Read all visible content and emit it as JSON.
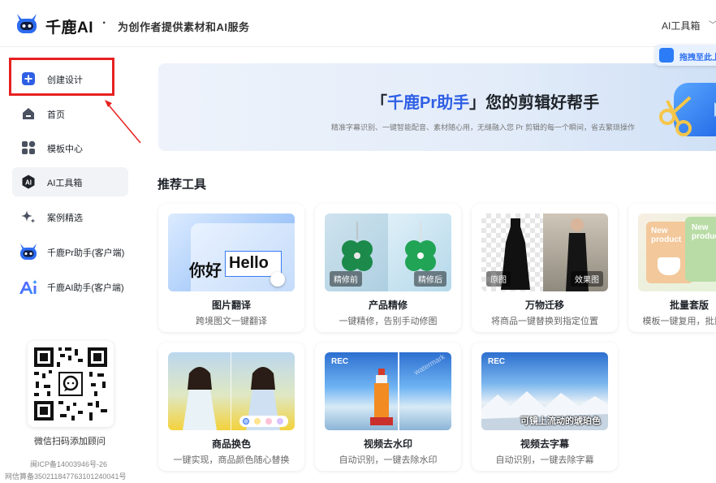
{
  "header": {
    "brand": "千鹿AI",
    "dot": "·",
    "slogan": "为创作者提供素材和AI服务",
    "right_menu": "AI工具箱"
  },
  "sidebar": {
    "items": [
      {
        "label": "创建设计",
        "icon": "plus-square-icon"
      },
      {
        "label": "首页",
        "icon": "home-icon"
      },
      {
        "label": "模板中心",
        "icon": "template-grid-icon"
      },
      {
        "label": "AI工具箱",
        "icon": "ai-toolbox-icon"
      },
      {
        "label": "案例精选",
        "icon": "sparkle-icon"
      },
      {
        "label": "千鹿Pr助手(客户端)",
        "icon": "qianlu-robot-icon"
      },
      {
        "label": "千鹿AI助手(客户端)",
        "icon": "ai-sparkle-icon"
      }
    ],
    "qr_caption": "微信扫码添加顾问",
    "icp": "闽ICP备14003946号-26",
    "gongan": "网信算备350211847763101240041号"
  },
  "banner": {
    "title_open": "「",
    "title_highlight": "千鹿Pr助手",
    "title_close": "」您的剪辑好帮手",
    "subtitle": "精准字幕识别、一键智能配音、素材随心用，无缝融入您 Pr 剪辑的每一个瞬间，省去繁琐操作",
    "float_badge": "拖拽至此上"
  },
  "section_title": "推荐工具",
  "tools": [
    {
      "title": "图片翻译",
      "desc": "跨境图文一键翻译",
      "thumb_text_1": "你好",
      "thumb_text_2": "Hello"
    },
    {
      "title": "产品精修",
      "desc": "一键精修，告别手动修图",
      "tag_left": "精修前",
      "tag_right": "精修后"
    },
    {
      "title": "万物迁移",
      "desc": "将商品一键替换到指定位置",
      "tag_left": "原图",
      "tag_right": "效果图"
    },
    {
      "title": "批量套版",
      "desc": "模板一键复用，批量",
      "thumb_text_1": "New product",
      "thumb_text_2": "New product"
    },
    {
      "title": "商品换色",
      "desc": "一键实现，商品颜色随心替换"
    },
    {
      "title": "视频去水印",
      "desc": "自动识别，一键去除水印",
      "rec": "REC",
      "watermark": "watermark"
    },
    {
      "title": "视频去字幕",
      "desc": "自动识别，一键去除字幕",
      "rec": "REC",
      "subtitle": "可镜上流动的琥珀色"
    }
  ],
  "colors": {
    "accent": "#2f5fe5",
    "highlight_red": "#e62121"
  }
}
